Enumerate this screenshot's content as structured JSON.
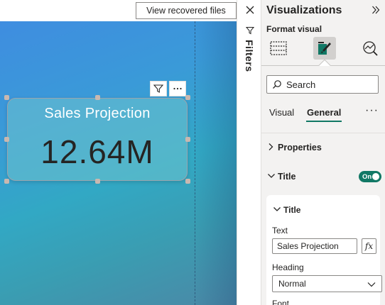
{
  "toolbar": {
    "recovered_files_label": "View recovered files"
  },
  "canvas": {
    "card": {
      "title": "Sales Projection",
      "value": "12.64M"
    }
  },
  "filters_pane": {
    "label": "Filters"
  },
  "visualizations": {
    "title": "Visualizations",
    "format_visual_label": "Format visual",
    "search_placeholder": "Search",
    "tabs": [
      {
        "label": "Visual",
        "active": false
      },
      {
        "label": "General",
        "active": true
      }
    ],
    "sections": {
      "properties": "Properties",
      "title": "Title",
      "title_toggle": "On",
      "title_sub": "Title"
    },
    "fields": {
      "text_label": "Text",
      "text_value": "Sales Projection",
      "fx_label": "fx",
      "heading_label": "Heading",
      "heading_value": "Normal",
      "font_label": "Font"
    }
  },
  "colors": {
    "accent": "#117865",
    "canvas_top": "#3f8de0",
    "canvas_bottom": "#4b88a6"
  }
}
